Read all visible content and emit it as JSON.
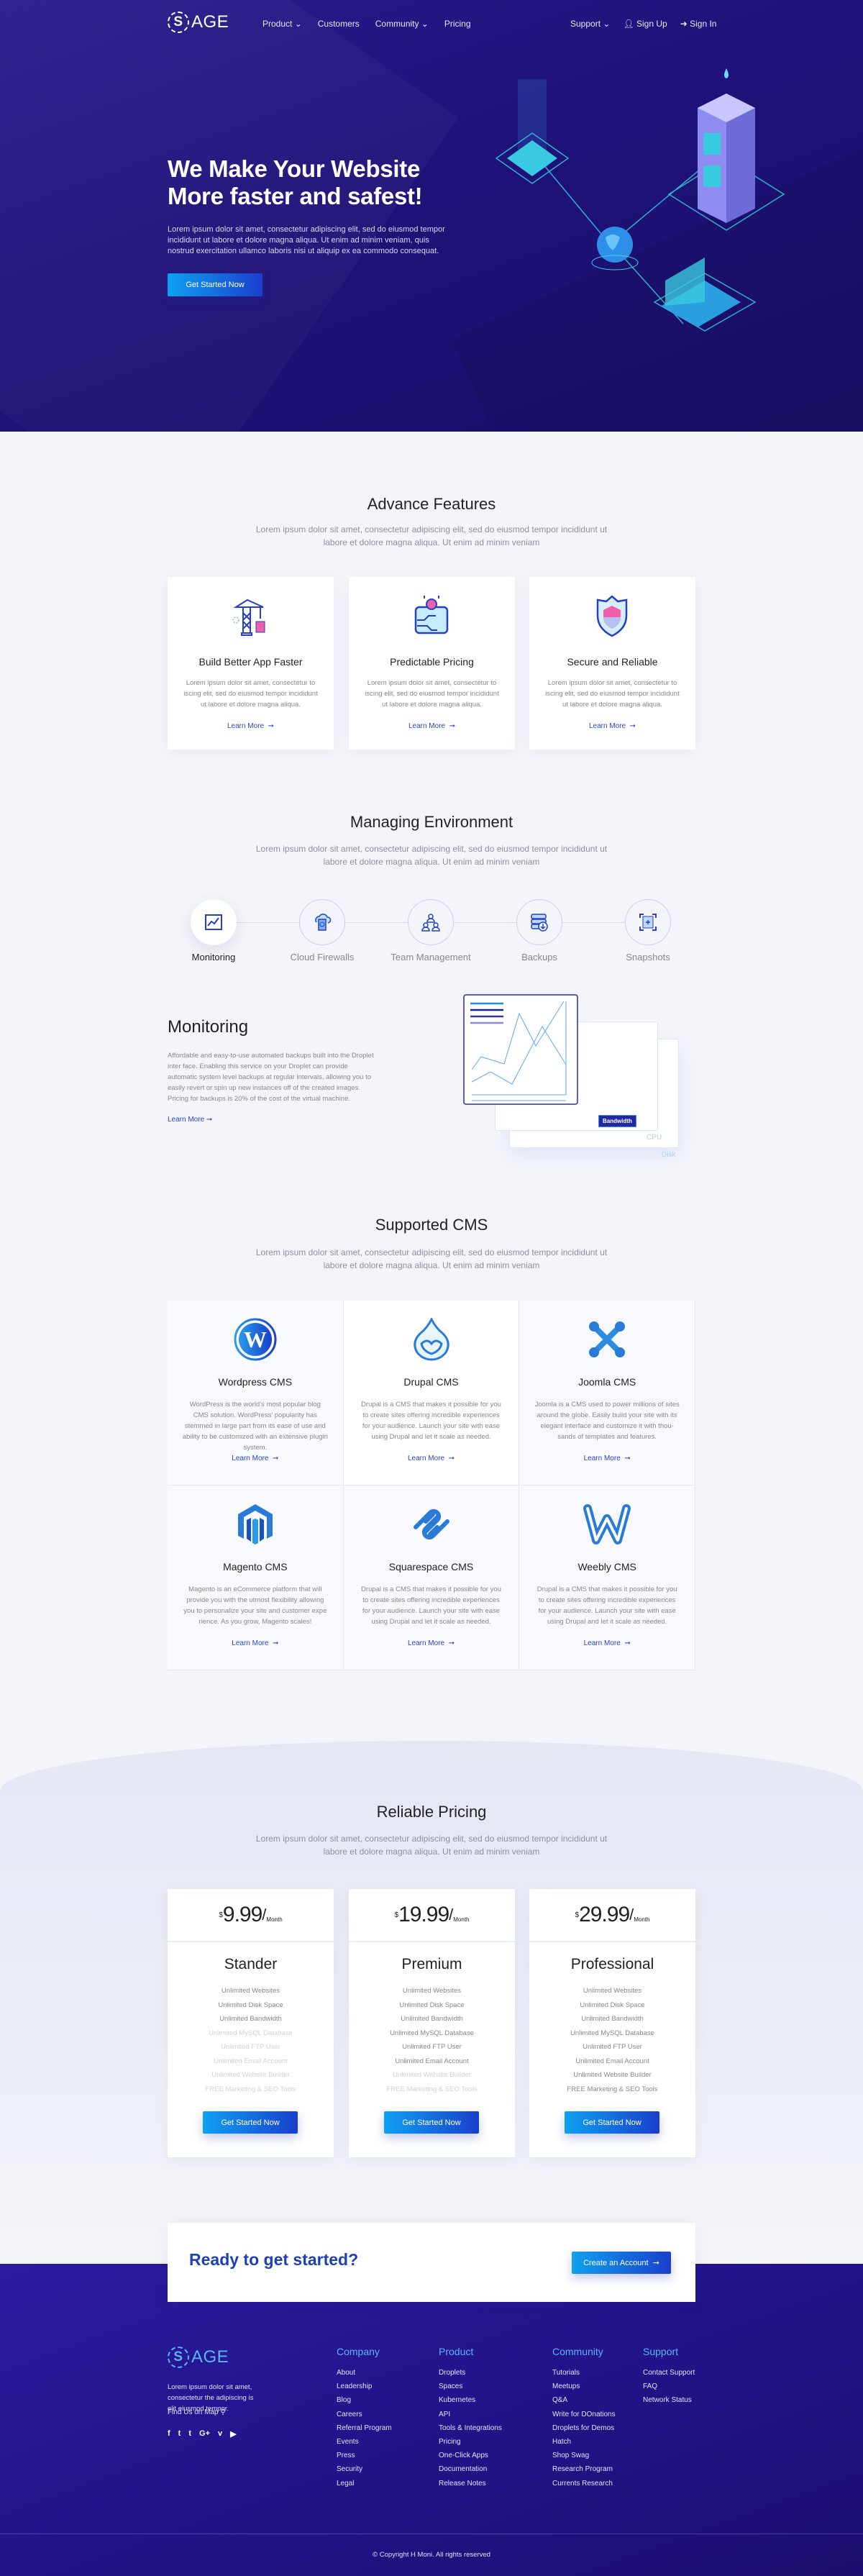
{
  "brand": {
    "logo_letter": "S",
    "logo_text": "AGE"
  },
  "nav": {
    "left": [
      {
        "label": "Product",
        "dropdown": true
      },
      {
        "label": "Customers",
        "dropdown": false
      },
      {
        "label": "Community",
        "dropdown": true
      },
      {
        "label": "Pricing",
        "dropdown": false
      }
    ],
    "support": "Support",
    "sign_up": "Sign Up",
    "sign_in": "Sign In"
  },
  "hero": {
    "title_line1": "We Make Your Website",
    "title_line2": "More faster and safest!",
    "text": "Lorem ipsum dolor sit amet, consectetur adipiscing elit, sed do eiusmod tempor incididunt ut labore et dolore magna aliqua. Ut enim ad minim veniam, quis nostrud exercitation ullamco laboris nisi ut aliquip ex ea commodo consequat.",
    "cta": "Get Started Now"
  },
  "features": {
    "title": "Advance Features",
    "subtitle": "Lorem ipsum dolor sit amet, consectetur adipiscing elit, sed do eiusmod tempor incididunt ut labore et dolore magna aliqua. Ut enim ad minim veniam",
    "cards": [
      {
        "icon": "crane-icon",
        "title": "Build Better App Faster",
        "text": "Lorem ipsum dolor sit amet, consectetur to iscing elit, sed do eiusmod tempor incididunt ut labore et dolore magna aliqua.",
        "link": "Learn More"
      },
      {
        "icon": "wallet-coin-icon",
        "title": "Predictable Pricing",
        "text": "Lorem ipsum dolor sit amet, consectetur to iscing elit, sed do eiusmod tempor incididunt ut labore et dolore magna aliqua.",
        "link": "Learn More"
      },
      {
        "icon": "shield-icon",
        "title": "Secure and Reliable",
        "text": "Lorem ipsum dolor sit amet, consectetur to iscing elit, sed do eiusmod tempor incididunt ut labore et dolore magna aliqua.",
        "link": "Learn More"
      }
    ]
  },
  "environment": {
    "title": "Managing Environment",
    "subtitle": "Lorem ipsum dolor sit amet, consectetur adipiscing elit, sed do eiusmod tempor incididunt ut labore et dolore magna aliqua. Ut enim ad minim veniam",
    "tabs": [
      {
        "label": "Monitoring",
        "icon": "chart-icon",
        "active": true
      },
      {
        "label": "Cloud Firewalls",
        "icon": "cloud-firewall-icon",
        "active": false
      },
      {
        "label": "Team Management",
        "icon": "team-icon",
        "active": false
      },
      {
        "label": "Backups",
        "icon": "backup-icon",
        "active": false
      },
      {
        "label": "Snapshots",
        "icon": "snapshot-icon",
        "active": false
      }
    ],
    "detail": {
      "title": "Monitoring",
      "text": "Affordable and easy-to-use automated backups built into the Droplet inter face. Enabling this service on your Droplet can provide automatic system level backups at regular intervals, allowing you to easily revert or spin up new instances off of the created images. Pricing for backups is 20% of the cost of the virtual machine.",
      "link": "Learn More",
      "illustration_labels": {
        "front": "Bandwidth",
        "middle": "CPU",
        "back": "Disk"
      }
    }
  },
  "cms": {
    "title": "Supported CMS",
    "subtitle": "Lorem ipsum dolor sit amet, consectetur adipiscing elit, sed do eiusmod tempor incididunt ut labore et dolore magna aliqua. Ut enim ad minim veniam",
    "items": [
      {
        "icon": "wordpress-icon",
        "title": "Wordpress CMS",
        "text": "WordPress is the world's most popular blog CMS solution. WordPress' popularity has stemmed in large part from its ease of use and ability to be customized with an extensive plugin system.",
        "link": "Learn More"
      },
      {
        "icon": "drupal-icon",
        "title": "Drupal CMS",
        "text": "Drupal is a CMS that makes it possible for you to create sites offering incredible experiences for your audience. Launch your site with ease using Drupal and let it scale as needed.",
        "link": "Learn More"
      },
      {
        "icon": "joomla-icon",
        "title": "Joomla CMS",
        "text": "Joomla is a CMS used to power millions of sites around the globe. Easily build your site with its elegant interface and customize it with thou-sands of templates and features.",
        "link": "Learn More"
      },
      {
        "icon": "magento-icon",
        "title": "Magento CMS",
        "text": "Magento is an eCommerce platform that will provide you with the utmost flexibility allowing you to personalize your site and customer expe rience. As you grow, Magento scales!",
        "link": "Learn More"
      },
      {
        "icon": "squarespace-icon",
        "title": "Squarespace CMS",
        "text": "Drupal is a CMS that makes it possible for you to create sites offering incredible experiences for your audience. Launch your site with ease using Drupal and let it scale as needed.",
        "link": "Learn More"
      },
      {
        "icon": "weebly-icon",
        "title": "Weebly CMS",
        "text": "Drupal is a CMS that makes it possible for you to create sites offering incredible experiences for your audience. Launch your site with ease using Drupal and let it scale as needed.",
        "link": "Learn More"
      }
    ]
  },
  "pricing": {
    "title": "Reliable Pricing",
    "subtitle": "Lorem ipsum dolor sit amet, consectetur adipiscing elit, sed do eiusmod tempor incididunt ut labore et dolore magna aliqua. Ut enim ad minim veniam",
    "currency": "$",
    "period": "/",
    "period_unit": "Month",
    "plans": [
      {
        "price": "9.99",
        "name": "Stander",
        "cta": "Get Started Now",
        "features": [
          {
            "label": "Unlimited Websites",
            "included": true
          },
          {
            "label": "Unlimited Disk Space",
            "included": true
          },
          {
            "label": "Unlimited Bandwidth",
            "included": true
          },
          {
            "label": "Unlimited MySQL Database",
            "included": false
          },
          {
            "label": "Unlimited FTP User",
            "included": false
          },
          {
            "label": "Unlimited Email Account",
            "included": false
          },
          {
            "label": "Unlimited Website Builder",
            "included": false
          },
          {
            "label": "FREE Marketing & SEO Tools",
            "included": false
          }
        ]
      },
      {
        "price": "19.99",
        "name": "Premium",
        "cta": "Get Started Now",
        "features": [
          {
            "label": "Unlimited Websites",
            "included": true
          },
          {
            "label": "Unlimited Disk Space",
            "included": true
          },
          {
            "label": "Unlimited Bandwidth",
            "included": true
          },
          {
            "label": "Unlimited MySQL Database",
            "included": true
          },
          {
            "label": "Unlimited FTP User",
            "included": true
          },
          {
            "label": "Unlimited Email Account",
            "included": true
          },
          {
            "label": "Unlimited Website Builder",
            "included": false
          },
          {
            "label": "FREE Marketing & SEO Tools",
            "included": false
          }
        ]
      },
      {
        "price": "29.99",
        "name": "Professional",
        "cta": "Get Started Now",
        "features": [
          {
            "label": "Unlimited Websites",
            "included": true
          },
          {
            "label": "Unlimited Disk Space",
            "included": true
          },
          {
            "label": "Unlimited Bandwidth",
            "included": true
          },
          {
            "label": "Unlimited MySQL Database",
            "included": true
          },
          {
            "label": "Unlimited FTP User",
            "included": true
          },
          {
            "label": "Unlimited Email Account",
            "included": true
          },
          {
            "label": "Unlimited Website Builder",
            "included": true
          },
          {
            "label": "FREE Marketing & SEO Tools",
            "included": true
          }
        ]
      }
    ]
  },
  "cta_box": {
    "title": "Ready to get started?",
    "button": "Create an Account"
  },
  "footer": {
    "about": "Lorem ipsum dolor sit amet, consectetur the adipiscing is elit eiusmod tempor.",
    "map_link": "Find Us on Map",
    "social": [
      {
        "icon": "facebook-icon",
        "glyph": "f"
      },
      {
        "icon": "twitter-icon",
        "glyph": "t"
      },
      {
        "icon": "tumblr-icon",
        "glyph": "t"
      },
      {
        "icon": "google-plus-icon",
        "glyph": "G+"
      },
      {
        "icon": "vimeo-icon",
        "glyph": "v"
      },
      {
        "icon": "youtube-icon",
        "glyph": "▶"
      }
    ],
    "columns": [
      {
        "title": "Company",
        "links": [
          "About",
          "Leadership",
          "Blog",
          "Careers",
          "Referral Program",
          "Events",
          "Press",
          "Security",
          "Legal"
        ]
      },
      {
        "title": "Product",
        "links": [
          "Droplets",
          "Spaces",
          "Kubernetes",
          "API",
          "Tools & Integrations",
          "Pricing",
          "One-Click Apps",
          "Documentation",
          "Release Notes"
        ]
      },
      {
        "title": "Community",
        "links": [
          "Tutorials",
          "Meetups",
          "Q&A",
          "Write for DOnations",
          "Droplets for Demos",
          "Hatch",
          "Shop Swag",
          "Research Program",
          "Currents Research"
        ]
      },
      {
        "title": "Support",
        "links": [
          "Contact Support",
          "FAQ",
          "Network Status"
        ]
      }
    ],
    "copyright": "© Copyright H Moni. All rights reserved"
  },
  "colors": {
    "accent": "#2a45c4",
    "hero_bg": "#1f137a",
    "button_start": "#0fa0f0",
    "button_end": "#1a3fcc",
    "footer_heading": "#5fb3f5"
  }
}
